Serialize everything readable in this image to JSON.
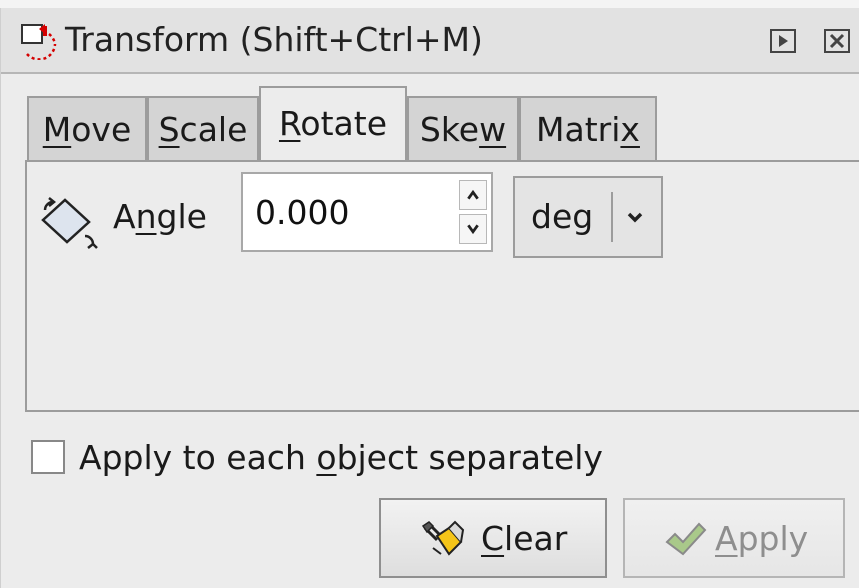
{
  "window": {
    "title": "Transform (Shift+Ctrl+M)",
    "buttons": {
      "expand_icon": "play-icon",
      "close_icon": "close-icon"
    }
  },
  "tabs": [
    {
      "pre": "",
      "key": "M",
      "post": "ove",
      "active": false
    },
    {
      "pre": "",
      "key": "S",
      "post": "cale",
      "active": false
    },
    {
      "pre": "",
      "key": "R",
      "post": "otate",
      "active": true
    },
    {
      "pre": "Ske",
      "key": "w",
      "post": "",
      "active": false
    },
    {
      "pre": "Matri",
      "key": "x",
      "post": "",
      "active": false
    }
  ],
  "rotate": {
    "angle_label_pre": "A",
    "angle_label_key": "n",
    "angle_label_post": "gle",
    "angle_value": "0.000",
    "unit": "deg"
  },
  "options": {
    "apply_each_pre": "Apply to each ",
    "apply_each_key": "o",
    "apply_each_post": "bject separately",
    "apply_each_checked": false
  },
  "actions": {
    "clear_key": "C",
    "clear_rest": "lear",
    "apply_key": "A",
    "apply_rest": "pply",
    "apply_enabled": false
  },
  "colors": {
    "background": "#ececec",
    "titlebar": "#e2e2e2",
    "icon_red": "#d40000",
    "brush_yellow": "#f5c518",
    "check_green": "#8bbf5a"
  }
}
